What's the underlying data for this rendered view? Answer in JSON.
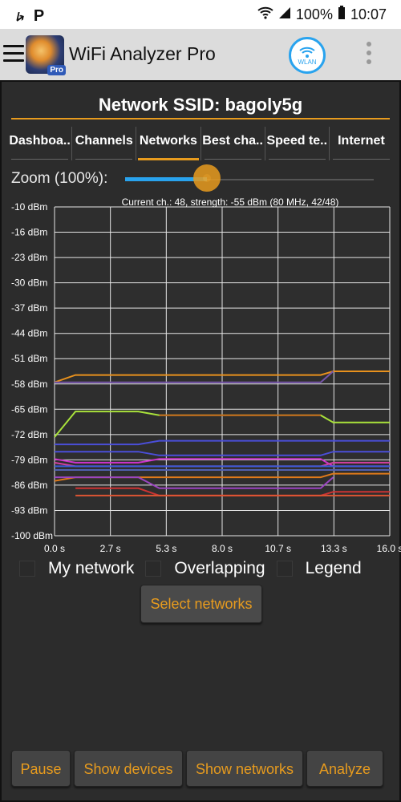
{
  "status_bar": {
    "left_icons": [
      "usb-icon",
      "parking-icon"
    ],
    "battery": "100%",
    "time": "10:07"
  },
  "app_bar": {
    "title": "WiFi Analyzer Pro",
    "logo_badge": "Pro",
    "wlan_label": "WLAN"
  },
  "network": {
    "ssid_label": "Network SSID: bagoly5g"
  },
  "tabs": [
    "Dashboa..",
    "Channels",
    "Networks",
    "Best cha..",
    "Speed te..",
    "Internet"
  ],
  "active_tab": "Networks",
  "zoom": {
    "label": "Zoom (100%):",
    "value": 0.33
  },
  "chart_data": {
    "type": "line",
    "title": "Current ch.: 48, strength: -55 dBm (80 MHz, 42/48)",
    "y_ticks": [
      "-10 dBm",
      "-16 dBm",
      "-23 dBm",
      "-30 dBm",
      "-37 dBm",
      "-44 dBm",
      "-51 dBm",
      "-58 dBm",
      "-65 dBm",
      "-72 dBm",
      "-79 dBm",
      "-86 dBm",
      "-93 dBm",
      "-100 dBm"
    ],
    "x_ticks": [
      "0.0 s",
      "2.7 s",
      "5.3 s",
      "8.0 s",
      "10.7 s",
      "13.3 s",
      "16.0 s"
    ],
    "xlim": [
      0,
      16
    ],
    "ylim": [
      -100,
      -10
    ],
    "grid": true,
    "series": [
      {
        "color": "#e8911d",
        "points": [
          [
            0,
            -58
          ],
          [
            1,
            -56
          ],
          [
            12.7,
            -56
          ],
          [
            13.3,
            -55
          ],
          [
            16,
            -55
          ]
        ]
      },
      {
        "color": "#7755aa",
        "points": [
          [
            0,
            -58
          ],
          [
            12.7,
            -58
          ],
          [
            13.3,
            -55
          ]
        ]
      },
      {
        "color": "#a9e23b",
        "points": [
          [
            0,
            -73
          ],
          [
            1,
            -66
          ],
          [
            4,
            -66
          ],
          [
            5,
            -67
          ],
          [
            12.7,
            -67
          ],
          [
            13.3,
            -69
          ],
          [
            16,
            -69
          ]
        ]
      },
      {
        "color": "#c2641c",
        "points": [
          [
            5,
            -67
          ],
          [
            12.7,
            -67
          ]
        ]
      },
      {
        "color": "#4a4ed8",
        "points": [
          [
            0,
            -75
          ],
          [
            4,
            -75
          ],
          [
            5,
            -74
          ],
          [
            16,
            -74
          ]
        ]
      },
      {
        "color": "#4a4ed8",
        "points": [
          [
            0,
            -77
          ],
          [
            4,
            -77
          ],
          [
            5,
            -78
          ],
          [
            12.7,
            -78
          ],
          [
            13.3,
            -77
          ],
          [
            16,
            -77
          ]
        ]
      },
      {
        "color": "#cc33cc",
        "points": [
          [
            0,
            -79
          ],
          [
            1,
            -80
          ],
          [
            4,
            -80
          ],
          [
            5,
            -79
          ],
          [
            12.7,
            -79
          ],
          [
            13.3,
            -81
          ],
          [
            16,
            -81
          ]
        ]
      },
      {
        "color": "#d040a0",
        "points": [
          [
            0,
            -80
          ],
          [
            1,
            -81
          ],
          [
            12.7,
            -81
          ],
          [
            13.3,
            -80
          ],
          [
            16,
            -80
          ]
        ]
      },
      {
        "color": "#3b5bd8",
        "points": [
          [
            0,
            -81
          ],
          [
            1,
            -81
          ],
          [
            4,
            -81
          ],
          [
            5,
            -81
          ],
          [
            16,
            -81
          ]
        ]
      },
      {
        "color": "#5060b0",
        "points": [
          [
            0,
            -82
          ],
          [
            4,
            -82
          ],
          [
            5,
            -82
          ],
          [
            16,
            -82
          ]
        ]
      },
      {
        "color": "#e07a1a",
        "points": [
          [
            0,
            -85
          ],
          [
            1,
            -84
          ],
          [
            12.7,
            -84
          ],
          [
            13.3,
            -83
          ],
          [
            16,
            -83
          ]
        ]
      },
      {
        "color": "#9b45c2",
        "points": [
          [
            0,
            -84
          ],
          [
            4,
            -84
          ],
          [
            5,
            -87
          ],
          [
            12.7,
            -87
          ],
          [
            13.3,
            -84
          ]
        ]
      },
      {
        "color": "#cc3333",
        "points": [
          [
            1,
            -87
          ],
          [
            4,
            -87
          ],
          [
            5,
            -89
          ],
          [
            12.7,
            -89
          ],
          [
            13.3,
            -88
          ],
          [
            16,
            -88
          ]
        ]
      },
      {
        "color": "#dd5533",
        "points": [
          [
            1,
            -89
          ],
          [
            12.7,
            -89
          ],
          [
            13.3,
            -89
          ],
          [
            16,
            -89
          ]
        ]
      }
    ]
  },
  "options": {
    "my_network": "My network",
    "overlapping": "Overlapping",
    "legend": "Legend"
  },
  "select_networks": "Select networks",
  "bottom_buttons": {
    "pause": "Pause",
    "show_devices": "Show devices",
    "show_networks": "Show networks",
    "analyze": "Analyze"
  }
}
